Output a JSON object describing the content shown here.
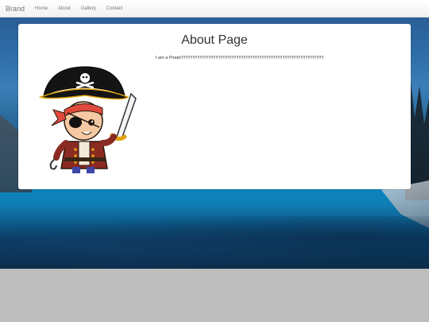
{
  "navbar": {
    "brand": "Brand",
    "links": [
      "Home",
      "About",
      "Gallery",
      "Contact"
    ]
  },
  "page": {
    "title": "About Page",
    "text": "I am a Pirate!!!!!!!!!!!!!!!!!!!!!!!!!!!!!!!!!!!!!!!!!!!!!!!!!!!!!!!!!!!!!!!!!!!!!!!!!!!!!!!!!!!!!!!!!!!!!!!!!!!!!!!!!!!!!!!!!!!!!!"
  },
  "image": {
    "icon": "pirate-illustration"
  },
  "colors": {
    "navbar_bg": "#f8f8f8",
    "nav_text": "#777777",
    "card_bg": "#ffffff",
    "page_bg": "#bdbdbd"
  }
}
